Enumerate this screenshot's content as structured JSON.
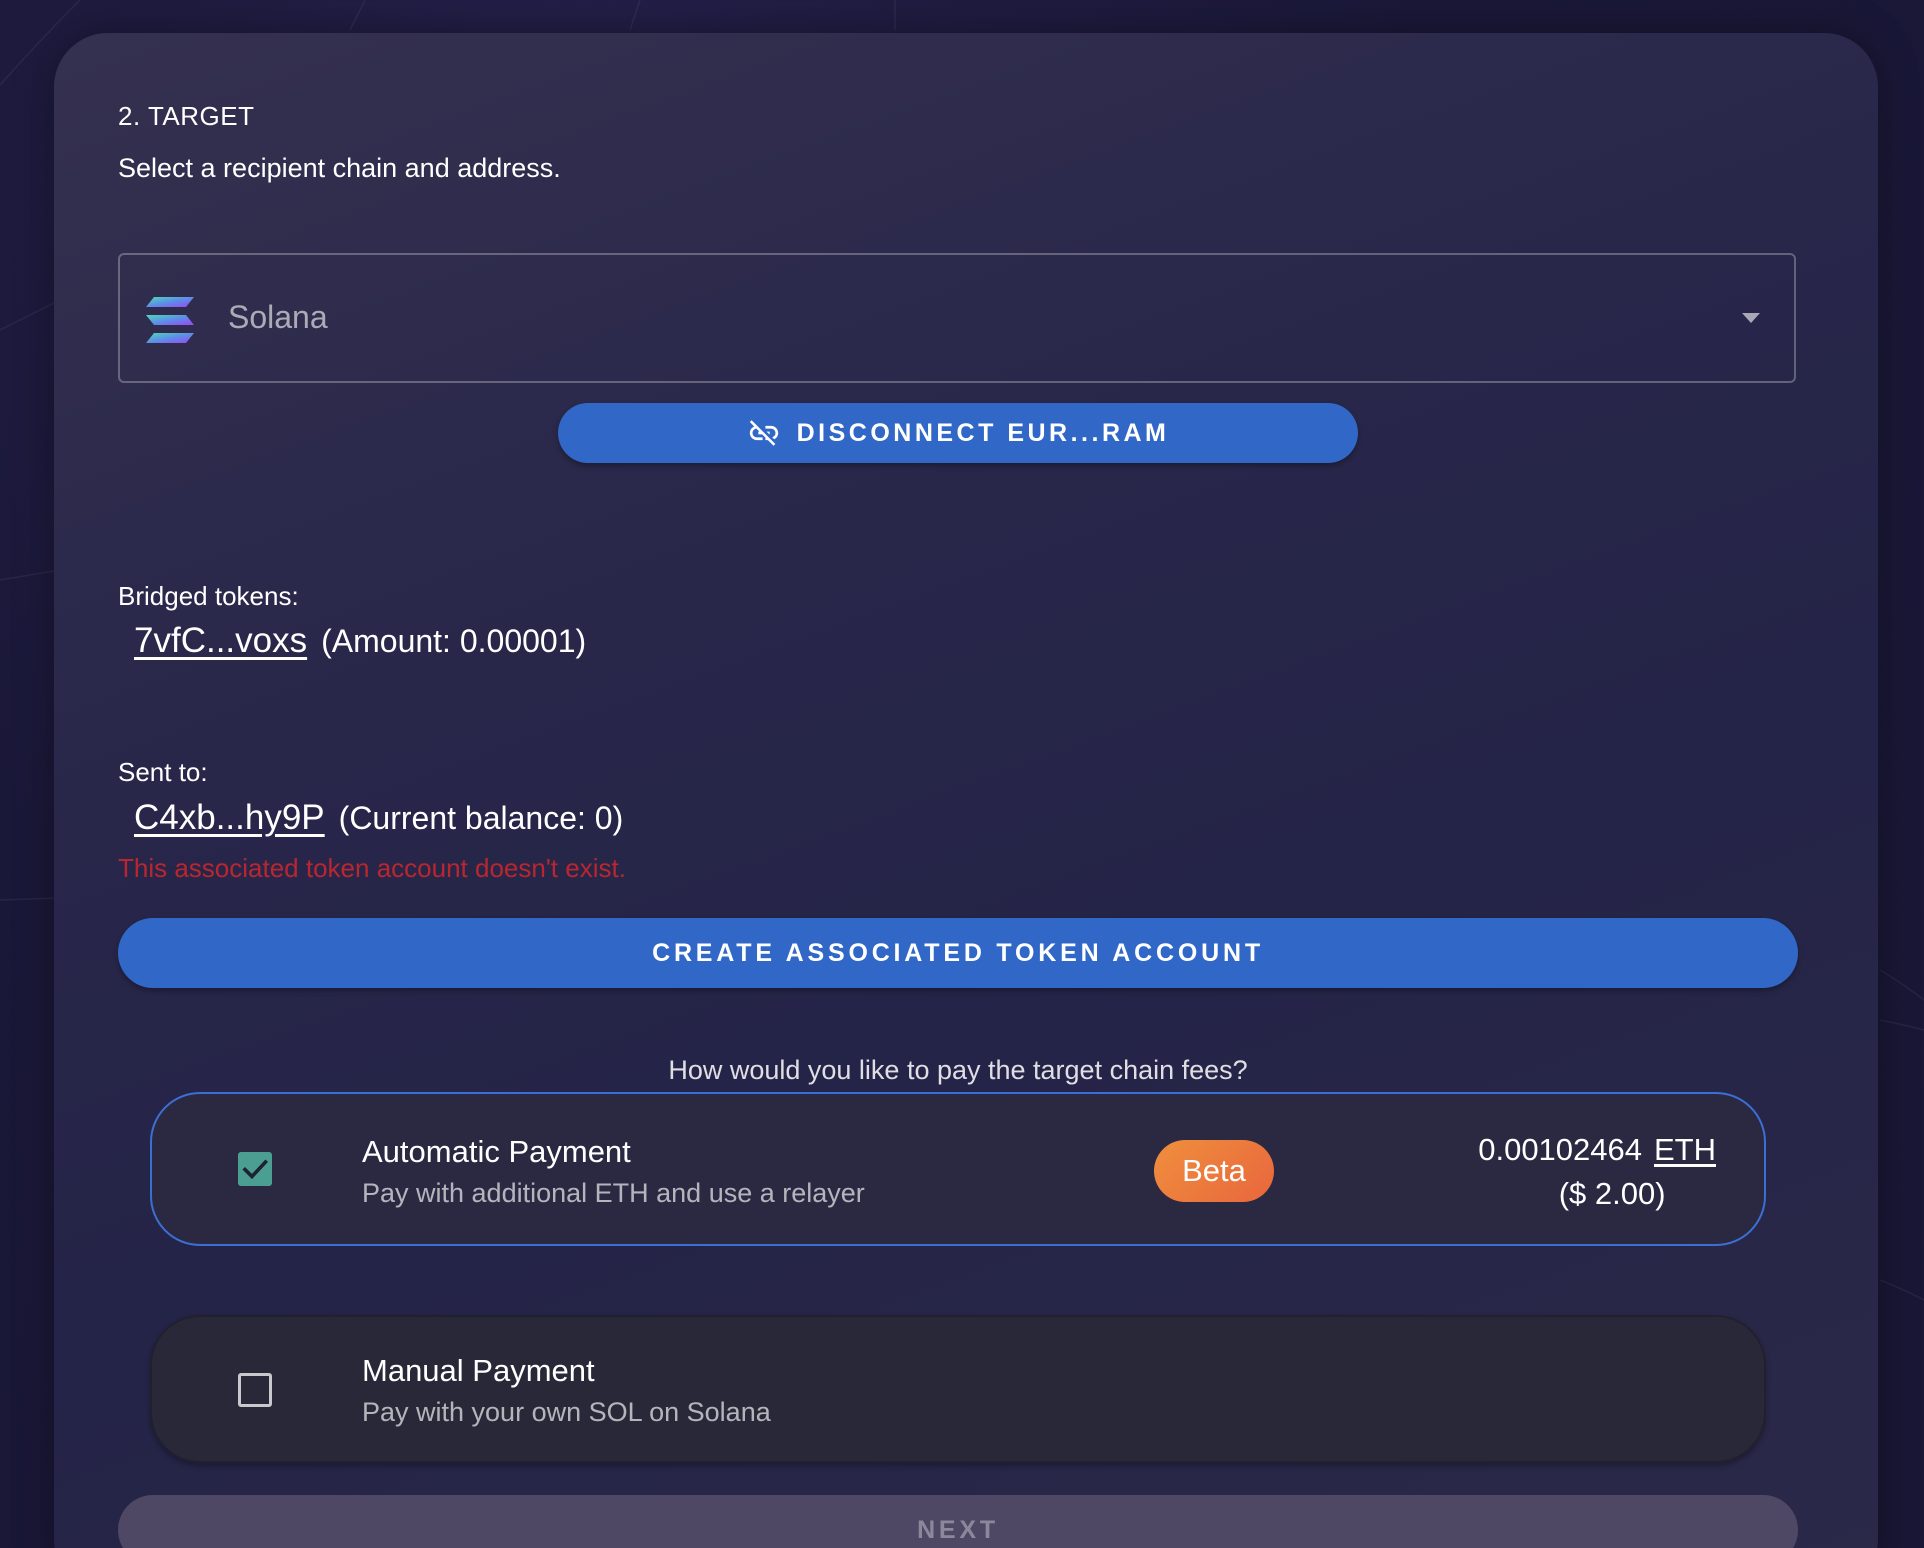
{
  "step": {
    "title": "2. TARGET",
    "subtitle": "Select a recipient chain and address."
  },
  "chain_select": {
    "selected": "Solana",
    "icon": "solana-logo"
  },
  "disconnect_button": {
    "label": "DISCONNECT EUR...RAM",
    "icon": "link-off-icon"
  },
  "bridged_tokens": {
    "label": "Bridged tokens:",
    "address": "7vfC...voxs",
    "amount": "(Amount: 0.00001)"
  },
  "sent_to": {
    "label": "Sent to:",
    "address": "C4xb...hy9P",
    "balance": "(Current balance: 0)",
    "error": "This associated token account doesn't exist."
  },
  "create_button": {
    "label": "CREATE ASSOCIATED TOKEN ACCOUNT"
  },
  "fees": {
    "question": "How would you like to pay the target chain fees?",
    "options": [
      {
        "title": "Automatic Payment",
        "description": "Pay with additional ETH and use a relayer",
        "badge": "Beta",
        "amount": "0.00102464",
        "unit": "ETH",
        "usd": "($ 2.00)",
        "selected": true
      },
      {
        "title": "Manual Payment",
        "description": "Pay with your own SOL on Solana",
        "selected": false
      }
    ]
  },
  "next_button": {
    "label": "NEXT"
  },
  "colors": {
    "primary_button": "#3168c7",
    "error": "#b9262f",
    "checkbox_checked": "#4a9f92",
    "beta_badge": "#ec7a3d",
    "selected_border": "#3b6fd4"
  }
}
